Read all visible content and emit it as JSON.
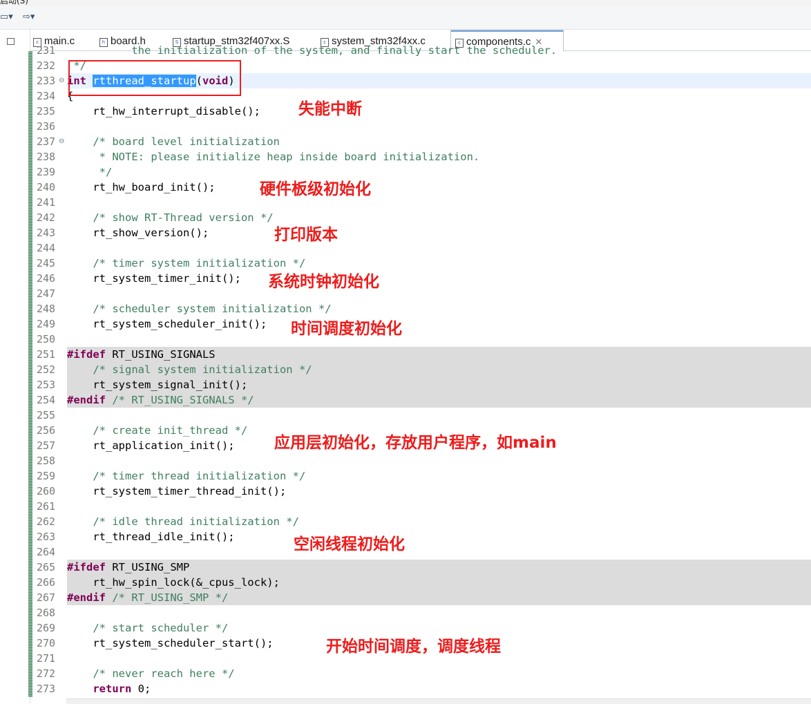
{
  "toolbar": {
    "frag": "启动(S)",
    "nav_left": "▭▾",
    "nav_right": "⇨▾"
  },
  "tabs": [
    {
      "label": "main.c",
      "icon": "c-file-icon"
    },
    {
      "label": "board.h",
      "icon": "h-file-icon"
    },
    {
      "label": "startup_stm32f407xx.S",
      "icon": "s-file-icon"
    },
    {
      "label": "system_stm32f4xx.c",
      "icon": "c-file-icon"
    },
    {
      "label": "components.c",
      "icon": "c-file-icon",
      "active": true
    }
  ],
  "line_numbers": [
    "231",
    "232",
    "233",
    "234",
    "235",
    "236",
    "237",
    "238",
    "239",
    "240",
    "241",
    "242",
    "243",
    "244",
    "245",
    "246",
    "247",
    "248",
    "249",
    "250",
    "251",
    "252",
    "253",
    "254",
    "255",
    "256",
    "257",
    "258",
    "259",
    "260",
    "261",
    "262",
    "263",
    "264",
    "265",
    "266",
    "267",
    "268",
    "269",
    "270",
    "271",
    "272",
    "273"
  ],
  "code": {
    "l231": "          the initialization of the system, and finally start the scheduler.",
    "l232": " */",
    "l233_kw": "int",
    "l233_fn": "rtthread_startup",
    "l233_open": "(",
    "l233_void": "void",
    "l233_close": ")",
    "l234": "{",
    "l235": "    rt_hw_interrupt_disable();",
    "l237": "    /* board level initialization",
    "l238": "     * NOTE: please initialize heap inside board initialization.",
    "l239": "     */",
    "l240": "    rt_hw_board_init();",
    "l242": "    /* show RT-Thread version */",
    "l243": "    rt_show_version();",
    "l245": "    /* timer system initialization */",
    "l246": "    rt_system_timer_init();",
    "l248": "    /* scheduler system initialization */",
    "l249": "    rt_system_scheduler_init();",
    "l251_kw": "#ifdef",
    "l251_rest": " RT_USING_SIGNALS",
    "l252": "    /* signal system initialization */",
    "l253": "    rt_system_signal_init();",
    "l254_kw": "#endif",
    "l254_cm": " /* RT_USING_SIGNALS */",
    "l256": "    /* create init_thread */",
    "l257": "    rt_application_init();",
    "l259": "    /* timer thread initialization */",
    "l260": "    rt_system_timer_thread_init();",
    "l262": "    /* idle thread initialization */",
    "l263": "    rt_thread_idle_init();",
    "l265_kw": "#ifdef",
    "l265_rest": " RT_USING_SMP",
    "l266": "    rt_hw_spin_lock(&_cpus_lock);",
    "l267_kw": "#endif",
    "l267_cm": " /* RT_USING_SMP */",
    "l269": "    /* start scheduler */",
    "l270": "    rt_system_scheduler_start();",
    "l272": "    /* never reach here */",
    "l273_kw": "    return",
    "l273_rest": " 0;"
  },
  "annotations": {
    "a1": "失能中断",
    "a2": "硬件板级初始化",
    "a3": "打印版本",
    "a4": "系统时钟初始化",
    "a5": "时间调度初始化",
    "a6": "应用层初始化，存放用户程序，如main",
    "a7": "空闲线程初始化",
    "a8": "开始时间调度，调度线程"
  },
  "colors": {
    "annotation": "#ee1c1c",
    "comment": "#3f7f5f",
    "keyword": "#7f0055",
    "selection": "#3399ff",
    "preprocessor_bg": "#dcdcdc"
  }
}
